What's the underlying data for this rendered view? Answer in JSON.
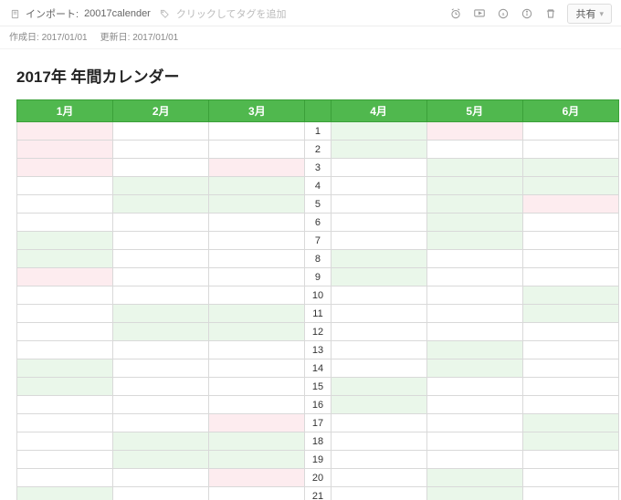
{
  "header": {
    "import_label": "インポート:",
    "note_name": "20017calender",
    "tag_hint": "クリックしてタグを追加",
    "share_label": "共有",
    "created_label": "作成日:",
    "created_value": "2017/01/01",
    "updated_label": "更新日:",
    "updated_value": "2017/01/01"
  },
  "doc": {
    "title": "2017年 年間カレンダー"
  },
  "months": [
    "1月",
    "2月",
    "3月",
    "4月",
    "5月",
    "6月"
  ],
  "days": [
    "1",
    "2",
    "3",
    "4",
    "5",
    "6",
    "7",
    "8",
    "9",
    "10",
    "11",
    "12",
    "13",
    "14",
    "15",
    "16",
    "17",
    "18",
    "19",
    "20",
    "21"
  ],
  "cell_colors": [
    [
      "pink",
      "blank",
      "blank",
      "green",
      "pink",
      "blank"
    ],
    [
      "pink",
      "blank",
      "blank",
      "green",
      "blank",
      "blank"
    ],
    [
      "pink",
      "blank",
      "pink",
      "blank",
      "green",
      "green"
    ],
    [
      "blank",
      "green",
      "green",
      "blank",
      "green",
      "green"
    ],
    [
      "blank",
      "green",
      "green",
      "blank",
      "green",
      "pink"
    ],
    [
      "blank",
      "blank",
      "blank",
      "blank",
      "green",
      "blank"
    ],
    [
      "green",
      "blank",
      "blank",
      "blank",
      "green",
      "blank"
    ],
    [
      "green",
      "blank",
      "blank",
      "green",
      "blank",
      "blank"
    ],
    [
      "pink",
      "blank",
      "blank",
      "green",
      "blank",
      "blank"
    ],
    [
      "blank",
      "blank",
      "blank",
      "blank",
      "blank",
      "green"
    ],
    [
      "blank",
      "green",
      "green",
      "blank",
      "blank",
      "green"
    ],
    [
      "blank",
      "green",
      "green",
      "blank",
      "blank",
      "blank"
    ],
    [
      "blank",
      "blank",
      "blank",
      "blank",
      "green",
      "blank"
    ],
    [
      "green",
      "blank",
      "blank",
      "blank",
      "green",
      "blank"
    ],
    [
      "green",
      "blank",
      "blank",
      "green",
      "blank",
      "blank"
    ],
    [
      "blank",
      "blank",
      "blank",
      "green",
      "blank",
      "blank"
    ],
    [
      "blank",
      "blank",
      "pink",
      "blank",
      "blank",
      "green"
    ],
    [
      "blank",
      "green",
      "green",
      "blank",
      "blank",
      "green"
    ],
    [
      "blank",
      "green",
      "green",
      "blank",
      "blank",
      "blank"
    ],
    [
      "blank",
      "blank",
      "pink",
      "blank",
      "green",
      "blank"
    ],
    [
      "green",
      "blank",
      "blank",
      "blank",
      "green",
      "blank"
    ]
  ]
}
